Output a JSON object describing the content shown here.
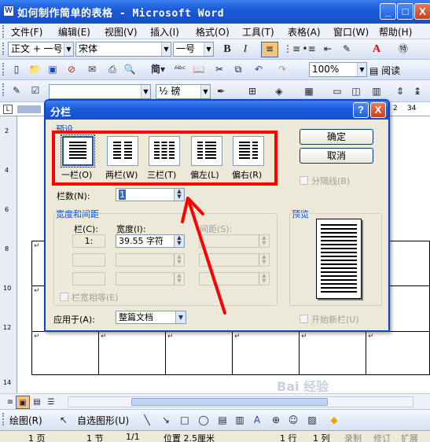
{
  "window": {
    "title": "如何制作简单的表格 - Microsoft Word",
    "app_icon": "word-icon",
    "controls": {
      "minimize": "_",
      "maximize": "□",
      "close": "X"
    }
  },
  "menubar": [
    "文件(F)",
    "编辑(E)",
    "视图(V)",
    "插入(I)",
    "格式(O)",
    "工具(T)",
    "表格(A)",
    "窗口(W)",
    "帮助(H)"
  ],
  "formatting_toolbar": {
    "style": "正文 + 一号",
    "font": "宋体",
    "size": "一号",
    "bold": "B",
    "italic": "I",
    "jianti": "简",
    "zoom": "100%",
    "reading": "阅读"
  },
  "drawing_toolbar": {
    "line_weight": "½ 磅"
  },
  "ruler": {
    "marks": [
      "2",
      "34"
    ]
  },
  "vertical_ruler": {
    "marks": [
      "2",
      "4",
      "6",
      "8",
      "10",
      "12",
      "14"
    ]
  },
  "document": {
    "cell_mark": "↵"
  },
  "draw_bar": {
    "draw": "绘图(R)",
    "autoshapes": "自选图形(U)"
  },
  "status_bar": {
    "page": "1 页",
    "section": "1 节",
    "pages": "1/1",
    "position": "位置 2.5厘米",
    "line": "1 行",
    "column": "1 列",
    "rec": "录制",
    "trk": "修订",
    "ext": "扩展"
  },
  "watermark": "Bai 经验",
  "dialog": {
    "title": "分栏",
    "help": "?",
    "close": "X",
    "presets_label": "预设",
    "presets": [
      {
        "label": "一栏(O)",
        "columns": 1,
        "selected": true
      },
      {
        "label": "两栏(W)",
        "columns": 2,
        "selected": false
      },
      {
        "label": "三栏(T)",
        "columns": 3,
        "selected": false
      },
      {
        "label": "偏左(L)",
        "columns": 2,
        "selected": false
      },
      {
        "label": "偏右(R)",
        "columns": 2,
        "selected": false
      }
    ],
    "num_columns_label": "栏数(N):",
    "num_columns_value": "1",
    "width_spacing_label": "宽度和间距",
    "col_header": "栏(C):",
    "width_header": "宽度(I):",
    "spacing_header": "间距(S):",
    "row1_col": "1:",
    "row1_width": "39.55 字符",
    "equal_width_label": "栏宽相等(E)",
    "apply_to_label": "应用于(A):",
    "apply_to_value": "整篇文档",
    "ok": "确定",
    "cancel": "取消",
    "line_between_label": "分隔线(B)",
    "preview_label": "预览",
    "start_new_column_label": "开始新栏(U)"
  },
  "annotation": {
    "highlight_color": "#ff0000"
  }
}
